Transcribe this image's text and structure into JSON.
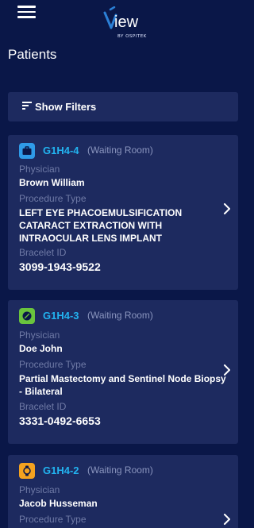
{
  "header": {
    "logo_word": "view",
    "logo_sub": "BY OSPITEK",
    "menu_icon": "hamburger-menu-icon"
  },
  "page": {
    "title": "Patients"
  },
  "filters": {
    "label": "Show Filters",
    "icon": "filter-lines-icon"
  },
  "labels": {
    "physician": "Physician",
    "procedure_type": "Procedure Type",
    "bracelet_id": "Bracelet ID"
  },
  "colors": {
    "background": "#0a1748",
    "card": "#1d2a5f",
    "accent_id": "#22b3f0",
    "muted_label": "#6f7aa6"
  },
  "patients": [
    {
      "id": "G1H4-4",
      "status": "(Waiting Room)",
      "icon": "briefcase-icon",
      "icon_color": "#2f9be8",
      "physician": "Brown William",
      "procedure": "LEFT EYE PHACOEMULSIFICATION CATARACT EXTRACTION WITH INTRAOCULAR LENS IMPLANT",
      "bracelet_id": "3099-1943-9522"
    },
    {
      "id": "G1H4-3",
      "status": "(Waiting Room)",
      "icon": "leaf-icon",
      "icon_color": "#6ac43d",
      "physician": "Doe John",
      "procedure": "Partial Mastectomy and Sentinel Node Biopsy - Bilateral",
      "bracelet_id": "3331-0492-6653"
    },
    {
      "id": "G1H4-2",
      "status": "(Waiting Room)",
      "icon": "watch-icon",
      "icon_color": "#f4a21f",
      "physician": "Jacob Husseman",
      "procedure": "",
      "bracelet_id": ""
    }
  ]
}
